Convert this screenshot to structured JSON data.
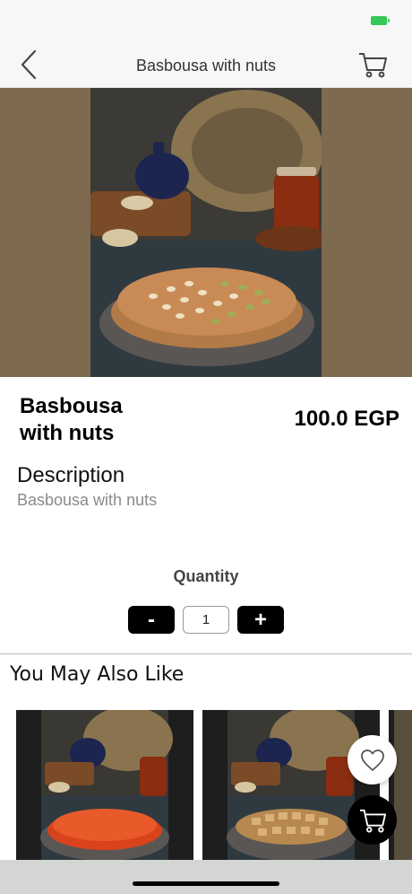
{
  "status_bar": {
    "battery_color": "#34c759"
  },
  "nav": {
    "title": "Basbousa with nuts",
    "back_icon": "chevron-left-icon",
    "cart_icon": "cart-icon"
  },
  "product": {
    "name": "Basbousa with nuts",
    "price": "100.0 EGP",
    "image": "basbousa-photo",
    "backdrop_color": "#7d6a4f"
  },
  "description": {
    "heading": "Description",
    "text": "Basbousa with nuts"
  },
  "quantity": {
    "label": "Quantity",
    "decrement_label": "-",
    "value": "1",
    "increment_label": "+"
  },
  "related": {
    "title": "You May Also Like",
    "items": [
      {
        "image": "kunafa-photo"
      },
      {
        "image": "baklava-photo"
      },
      {
        "image": "partial-photo"
      }
    ]
  },
  "floating": {
    "favorite_icon": "heart-icon",
    "cart_icon": "cart-icon"
  }
}
